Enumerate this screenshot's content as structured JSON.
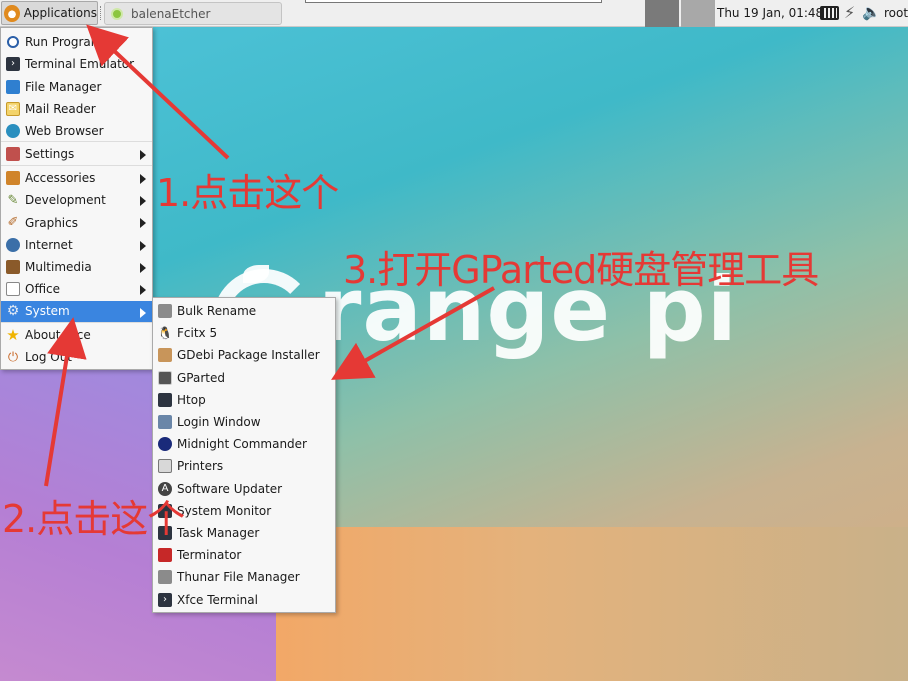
{
  "panel": {
    "apps_label": "Applications",
    "task_label": "balenaEtcher",
    "clock": "Thu 19 Jan, 01:48",
    "user": "root"
  },
  "desktop": {
    "logo_text": "range pi"
  },
  "app_menu": {
    "items": [
      {
        "label": "Run Program...",
        "icon": "search-icon"
      },
      {
        "label": "Terminal Emulator",
        "icon": "terminal-icon"
      },
      {
        "label": "File Manager",
        "icon": "file-manager-icon"
      },
      {
        "label": "Mail Reader",
        "icon": "mail-icon"
      },
      {
        "label": "Web Browser",
        "icon": "globe-icon"
      },
      {
        "label": "Settings",
        "icon": "settings-icon",
        "submenu": true
      },
      {
        "label": "Accessories",
        "icon": "accessories-icon",
        "submenu": true
      },
      {
        "label": "Development",
        "icon": "development-icon",
        "submenu": true
      },
      {
        "label": "Graphics",
        "icon": "graphics-icon",
        "submenu": true
      },
      {
        "label": "Internet",
        "icon": "internet-icon",
        "submenu": true
      },
      {
        "label": "Multimedia",
        "icon": "multimedia-icon",
        "submenu": true
      },
      {
        "label": "Office",
        "icon": "office-icon",
        "submenu": true
      },
      {
        "label": "System",
        "icon": "system-gear-icon",
        "submenu": true,
        "active": true
      },
      {
        "label": "About Xfce",
        "icon": "star-icon"
      },
      {
        "label": "Log Out",
        "icon": "logout-icon"
      }
    ]
  },
  "system_menu": {
    "items": [
      {
        "label": "Bulk Rename",
        "icon": "bulk-rename-icon"
      },
      {
        "label": "Fcitx 5",
        "icon": "penguin-icon"
      },
      {
        "label": "GDebi Package Installer",
        "icon": "package-icon"
      },
      {
        "label": "GParted",
        "icon": "gparted-icon"
      },
      {
        "label": "Htop",
        "icon": "htop-icon"
      },
      {
        "label": "Login Window",
        "icon": "login-window-icon"
      },
      {
        "label": "Midnight Commander",
        "icon": "midnight-commander-icon"
      },
      {
        "label": "Printers",
        "icon": "printer-icon"
      },
      {
        "label": "Software Updater",
        "icon": "updater-icon"
      },
      {
        "label": "System Monitor",
        "icon": "system-monitor-icon"
      },
      {
        "label": "Task Manager",
        "icon": "task-manager-icon"
      },
      {
        "label": "Terminator",
        "icon": "terminator-icon"
      },
      {
        "label": "Thunar File Manager",
        "icon": "thunar-icon"
      },
      {
        "label": "Xfce Terminal",
        "icon": "xfce-terminal-icon"
      }
    ]
  },
  "annotations": {
    "step1": "1.点击这个",
    "step2": "2.点击这个",
    "step3": "3.打开GParted硬盘管理工具",
    "color": "#e53935"
  }
}
